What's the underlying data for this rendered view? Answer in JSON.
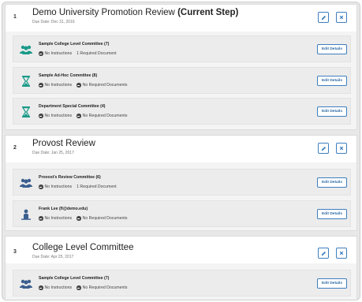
{
  "steps": [
    {
      "number": "1",
      "title": "Demo University Promotion Review",
      "current_label": "(Current Step)",
      "due": "Due Date: Dec 31, 2016",
      "committees": [
        {
          "name": "Sample College Level Committee (7)",
          "instructions": "No Instructions",
          "documents": "1 Required Document",
          "documents_badge": false,
          "icon": "group-icon",
          "icon_color": "#1a9a8a"
        },
        {
          "name": "Sample Ad-Hoc Committee (8)",
          "instructions": "No Instructions",
          "documents": "No Required Documents",
          "documents_badge": true,
          "icon": "hourglass-icon",
          "icon_color": "#1a9a8a"
        },
        {
          "name": "Department Special Committee (4)",
          "instructions": "No Instructions",
          "documents": "No Required Documents",
          "documents_badge": true,
          "icon": "hourglass-icon",
          "icon_color": "#1a9a8a"
        }
      ]
    },
    {
      "number": "2",
      "title": "Provost Review",
      "current_label": "",
      "due": "Due Date: Jan 25, 2017",
      "committees": [
        {
          "name": "Provost's Review Committee (6)",
          "instructions": "No Instructions",
          "documents": "1 Required Document",
          "documents_badge": false,
          "icon": "group-icon",
          "icon_color": "#3b5f8f"
        },
        {
          "name": "Frank Lee (fl@demo.edu)",
          "instructions": "No Instructions",
          "documents": "No Required Documents",
          "documents_badge": true,
          "icon": "person-icon",
          "icon_color": "#3b5f8f"
        }
      ]
    },
    {
      "number": "3",
      "title": "College Level Committee",
      "current_label": "",
      "due": "Due Date: Apr 25, 2017",
      "committees": [
        {
          "name": "Sample College Level Committee (7)",
          "instructions": "No Instructions",
          "documents": "No Required Documents",
          "documents_badge": true,
          "icon": "group-icon",
          "icon_color": "#3b5f8f"
        }
      ]
    }
  ],
  "edit_details_label": "Edit Details",
  "colors": {
    "accent": "#3d7ebf",
    "teal": "#1a9a8a",
    "navy": "#3b5f8f"
  }
}
